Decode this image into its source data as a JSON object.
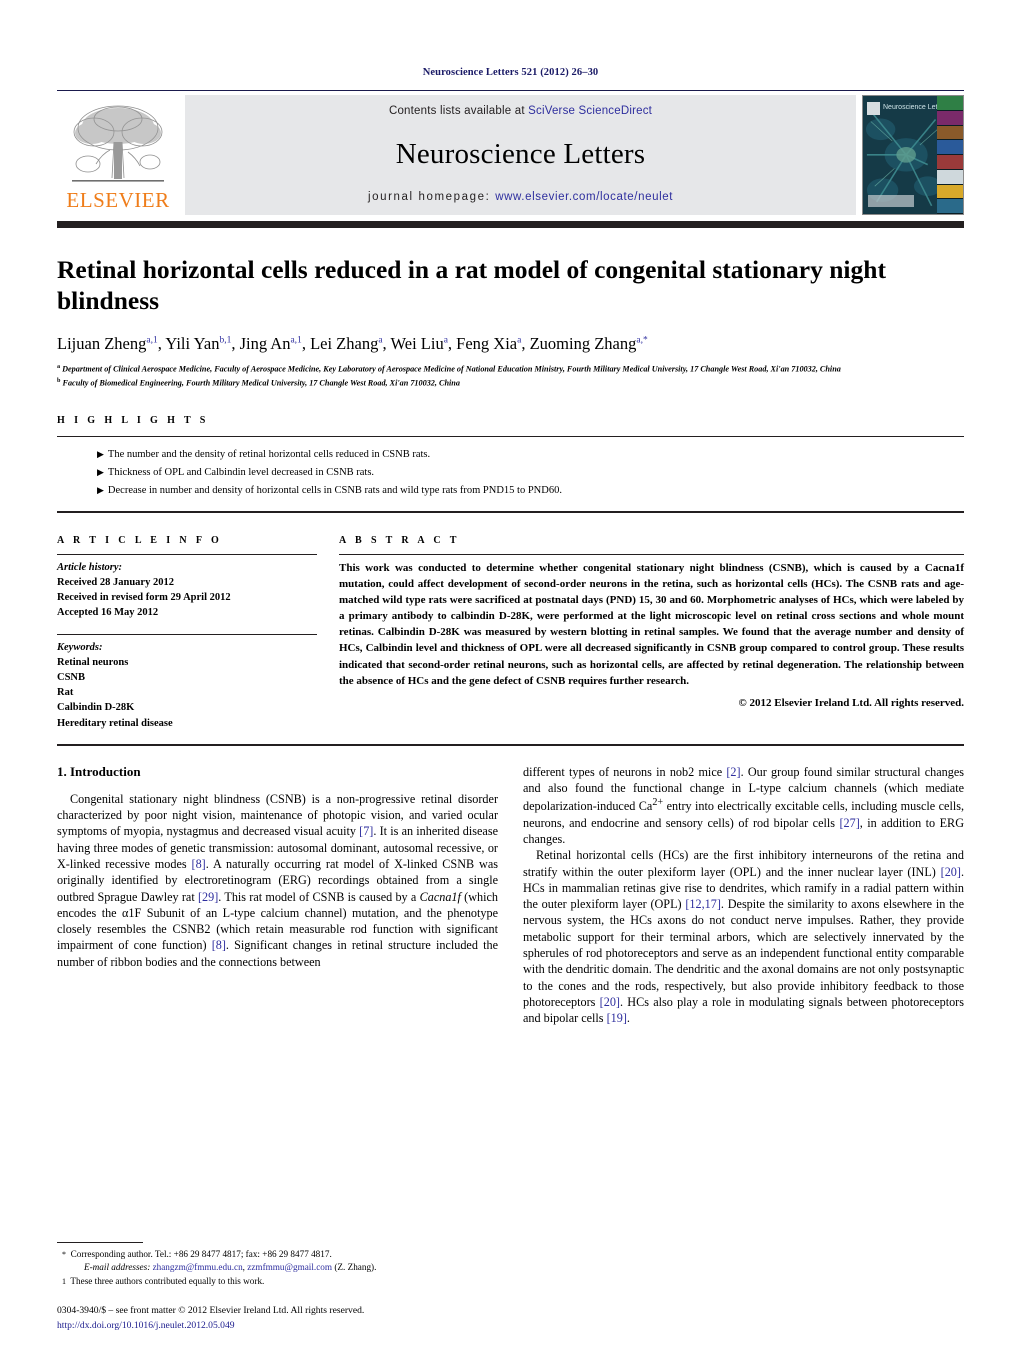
{
  "running_head": "Neuroscience Letters 521 (2012) 26–30",
  "masthead": {
    "publisher_logo_text": "ELSEVIER",
    "contents_prefix": "Contents lists available at ",
    "contents_link": "SciVerse ScienceDirect",
    "journal_name": "Neuroscience Letters",
    "homepage_prefix": "journal homepage: ",
    "homepage_link": "www.elsevier.com/locate/neulet",
    "cover_title": "Neuroscience Letters",
    "link_color": "#2e2e9e",
    "panel_color": "#e6e7e9",
    "cover_bg_color": "#12333f"
  },
  "article": {
    "title": "Retinal horizontal cells reduced in a rat model of congenital stationary night blindness",
    "authors_html": "Lijuan Zheng<sup>a,1</sup>, Yili Yan<sup>b,1</sup>, Jing An<sup>a,1</sup>, Lei Zhang<sup>a</sup>, Wei Liu<sup>a</sup>, Feng Xia<sup>a</sup>, Zuoming Zhang<sup>a,</sup><sup>*</sup>",
    "affiliation_a": "Department of Clinical Aerospace Medicine, Faculty of Aerospace Medicine, Key Laboratory of Aerospace Medicine of National Education Ministry, Fourth Military Medical University, 17 Changle West Road, Xi'an 710032, China",
    "affiliation_b": "Faculty of Biomedical Engineering, Fourth Military Medical University, 17 Changle West Road, Xi'an 710032, China"
  },
  "highlights": {
    "label": "H I G H L I G H T S",
    "items": [
      "The number and the density of retinal horizontal cells reduced in CSNB rats.",
      "Thickness of OPL and Calbindin level decreased in CSNB rats.",
      "Decrease in number and density of horizontal cells in CSNB rats and wild type rats from PND15 to PND60."
    ]
  },
  "article_info": {
    "label": "A R T I C L E    I N F O",
    "history_heading": "Article history:",
    "history": [
      "Received 28 January 2012",
      "Received in revised form 29 April 2012",
      "Accepted 16 May 2012"
    ],
    "keywords_heading": "Keywords:",
    "keywords": [
      "Retinal neurons",
      "CSNB",
      "Rat",
      "Calbindin D-28K",
      "Hereditary retinal disease"
    ]
  },
  "abstract": {
    "label": "A B S T R A C T",
    "text": "This work was conducted to determine whether congenital stationary night blindness (CSNB), which is caused by a Cacna1f mutation, could affect development of second-order neurons in the retina, such as horizontal cells (HCs). The CSNB rats and age-matched wild type rats were sacrificed at postnatal days (PND) 15, 30 and 60. Morphometric analyses of HCs, which were labeled by a primary antibody to calbindin D-28K, were performed at the light microscopic level on retinal cross sections and whole mount retinas. Calbindin D-28K was measured by western blotting in retinal samples. We found that the average number and density of HCs, Calbindin level and thickness of OPL were all decreased significantly in CSNB group compared to control group. These results indicated that second-order retinal neurons, such as horizontal cells, are affected by retinal degeneration. The relationship between the absence of HCs and the gene defect of CSNB requires further research.",
    "copyright": "© 2012 Elsevier Ireland Ltd. All rights reserved."
  },
  "introduction": {
    "heading": "1. Introduction",
    "left_para_1_html": "Congenital stationary night blindness (CSNB) is a non-progressive retinal disorder characterized by poor night vision, maintenance of photopic vision, and varied ocular symptoms of myopia, nystagmus and decreased visual acuity <span class=\"ref\">[7]</span>. It is an inherited disease having three modes of genetic transmission: autosomal dominant, autosomal recessive, or X-linked recessive modes <span class=\"ref\">[8]</span>. A naturally occurring rat model of X-linked CSNB was originally identified by electroretinogram (ERG) recordings obtained from a single outbred Sprague Dawley rat <span class=\"ref\">[29]</span>. This rat model of CSNB is caused by a <span class=\"it\">Cacna1f</span> (which encodes the α1F Subunit of an L-type calcium channel) mutation, and the phenotype closely resembles the CSNB2 (which retain measurable rod function with significant impairment of cone function) <span class=\"ref\">[8]</span>. Significant changes in retinal structure included the number of ribbon bodies and the connections between",
    "right_para_1_html": "different types of neurons in nob2 mice <span class=\"ref\">[2]</span>. Our group found similar structural changes and also found the functional change in L-type calcium channels (which mediate depolarization-induced Ca<sup>2+</sup> entry into electrically excitable cells, including muscle cells, neurons, and endocrine and sensory cells) of rod bipolar cells <span class=\"ref\">[27]</span>, in addition to ERG changes.",
    "right_para_2_html": "Retinal horizontal cells (HCs) are the first inhibitory interneurons of the retina and stratify within the outer plexiform layer (OPL) and the inner nuclear layer (INL) <span class=\"ref\">[20]</span>. HCs in mammalian retinas give rise to dendrites, which ramify in a radial pattern within the outer plexiform layer (OPL) <span class=\"ref\">[12,17]</span>. Despite the similarity to axons elsewhere in the nervous system, the HCs axons do not conduct nerve impulses. Rather, they provide metabolic support for their terminal arbors, which are selectively innervated by the spherules of rod photoreceptors and serve as an independent functional entity comparable with the dendritic domain. The dendritic and the axonal domains are not only postsynaptic to the cones and the rods, respectively, but also provide inhibitory feedback to those photoreceptors <span class=\"ref\">[20]</span>. HCs also play a role in modulating signals between photoreceptors and bipolar cells <span class=\"ref\">[19]</span>."
  },
  "footnotes": {
    "corresponding_html": "<span class=\"mark\">*</span>&nbsp; Corresponding author. Tel.: +86 29 8477 4817; fax: +86 29 8477 4817.",
    "email_html": "<i>E-mail addresses:</i> <span class=\"lnk\">zhangzm@fmmu.edu.cn</span>, <span class=\"lnk\">zzmfmmu@gmail.com</span> (Z. Zhang).",
    "equal_contrib_html": "<span class=\"mark\">1</span>&nbsp; These three authors contributed equally to this work."
  },
  "imprint": {
    "line1": "0304-3940/$ – see front matter © 2012 Elsevier Ireland Ltd. All rights reserved.",
    "doi": "http://dx.doi.org/10.1016/j.neulet.2012.05.049"
  }
}
